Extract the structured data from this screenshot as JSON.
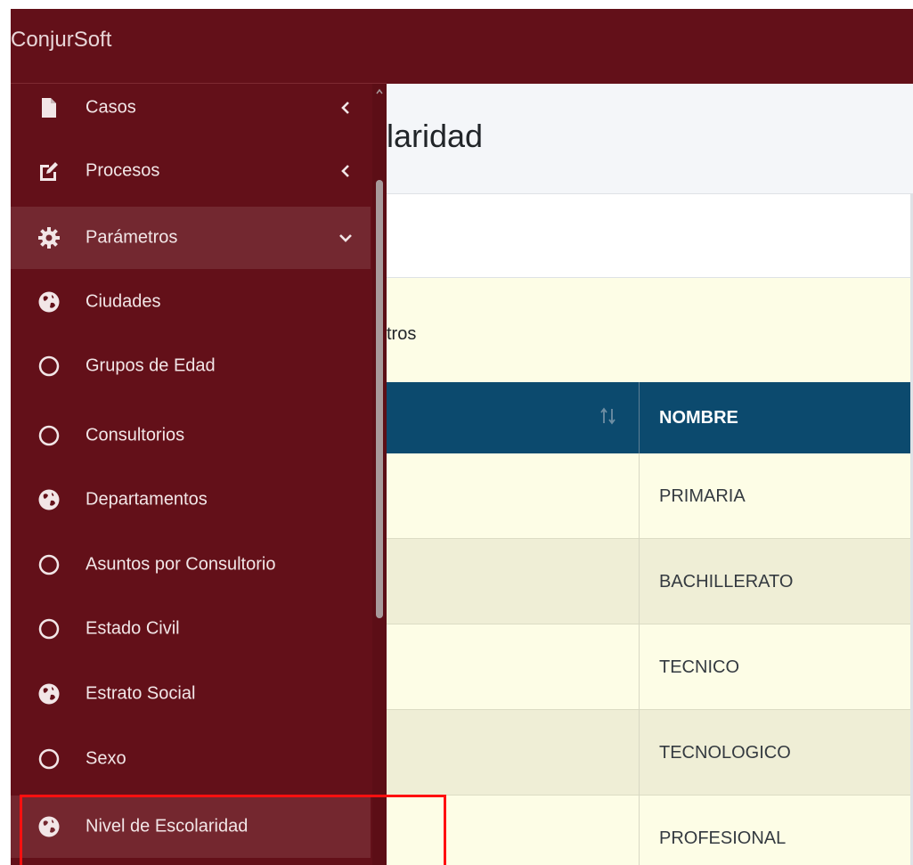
{
  "app": {
    "brand": "ConjurSoft"
  },
  "page": {
    "title_fragment": "laridad",
    "info_text_fragment": "tros"
  },
  "sidebar": {
    "items": [
      {
        "label": "Casos",
        "icon": "file-icon",
        "chevron": "left"
      },
      {
        "label": "Procesos",
        "icon": "edit-icon",
        "chevron": "left"
      },
      {
        "label": "Parámetros",
        "icon": "gear-icon",
        "chevron": "down",
        "active": true
      },
      {
        "label": "Ciudades",
        "icon": "globe-icon"
      },
      {
        "label": "Grupos de Edad",
        "icon": "circle-icon"
      },
      {
        "label": "Consultorios",
        "icon": "circle-icon"
      },
      {
        "label": "Departamentos",
        "icon": "globe-icon"
      },
      {
        "label": "Asuntos por Consultorio",
        "icon": "circle-icon"
      },
      {
        "label": "Estado Civil",
        "icon": "circle-icon"
      },
      {
        "label": "Estrato Social",
        "icon": "globe-icon"
      },
      {
        "label": "Sexo",
        "icon": "circle-icon"
      },
      {
        "label": "Nivel de Escolaridad",
        "icon": "globe-icon",
        "highlighted": true
      }
    ]
  },
  "table": {
    "columns": [
      "",
      "NOMBRE"
    ],
    "rows": [
      {
        "nombre": "PRIMARIA"
      },
      {
        "nombre": "BACHILLERATO"
      },
      {
        "nombre": "TECNICO"
      },
      {
        "nombre": "TECNOLOGICO"
      },
      {
        "nombre": "PROFESIONAL"
      }
    ]
  },
  "colors": {
    "sidebar_bg": "#631019",
    "table_header_bg": "#0c4a6e",
    "row_odd": "#efeed6",
    "row_even": "#fdfde6",
    "annotation": "#ff1010"
  }
}
